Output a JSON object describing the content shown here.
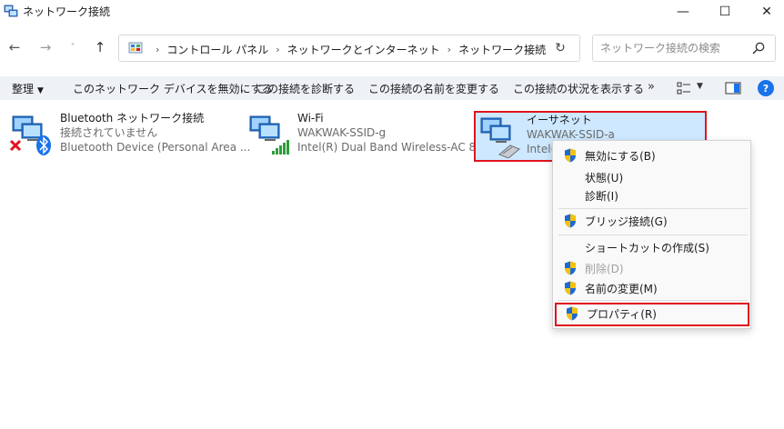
{
  "window": {
    "title": "ネットワーク接続",
    "minimize_glyph": "—",
    "maximize_glyph": "☐",
    "close_glyph": "✕"
  },
  "nav": {
    "back_glyph": "←",
    "forward_glyph": "→",
    "history_glyph": "˅",
    "up_glyph": "↑"
  },
  "address": {
    "sep_glyph": "›",
    "crumbs": [
      "コントロール パネル",
      "ネットワークとインターネット",
      "ネットワーク接続"
    ],
    "dropdown_glyph": "⌄",
    "refresh_glyph": "↻"
  },
  "search": {
    "placeholder": "ネットワーク接続の検索",
    "icon": "search-icon"
  },
  "commands": {
    "organize": "整理",
    "organize_arrow": "▼",
    "disable_device": "このネットワーク デバイスを無効にする",
    "diagnose": "この接続を診断する",
    "rename": "この接続の名前を変更する",
    "view_status": "この接続の状況を表示する",
    "more_glyph": "»",
    "view_drop_glyph": "▼",
    "help_glyph": "?"
  },
  "items": [
    {
      "name": "Bluetooth ネットワーク接続",
      "status": "接続されていません",
      "device": "Bluetooth Device (Personal Area ..."
    },
    {
      "name": "Wi-Fi",
      "status": "WAKWAK-SSID-g",
      "device": "Intel(R) Dual Band Wireless-AC 82..."
    },
    {
      "name": "イーサネット",
      "status": "WAKWAK-SSID-a",
      "device": "Intel("
    }
  ],
  "context_menu": {
    "items": [
      {
        "label": "無効にする(B)",
        "shield": true,
        "enabled": true
      },
      {
        "label": "状態(U)",
        "shield": false,
        "enabled": true
      },
      {
        "label": "診断(I)",
        "shield": false,
        "enabled": true
      },
      {
        "label": "ブリッジ接続(G)",
        "shield": true,
        "enabled": true
      },
      {
        "label": "ショートカットの作成(S)",
        "shield": false,
        "enabled": true
      },
      {
        "label": "削除(D)",
        "shield": true,
        "enabled": false
      },
      {
        "label": "名前の変更(M)",
        "shield": true,
        "enabled": true
      },
      {
        "label": "プロパティ(R)",
        "shield": true,
        "enabled": true,
        "highlighted": true
      }
    ]
  },
  "colors": {
    "command_bar_bg": "#eef1f6",
    "selection_bg": "#cde8ff",
    "highlight_border": "#e0141e",
    "help_blue": "#1a73e8",
    "shield_blue": "#1e6ad2",
    "shield_yellow": "#f4c20d"
  }
}
